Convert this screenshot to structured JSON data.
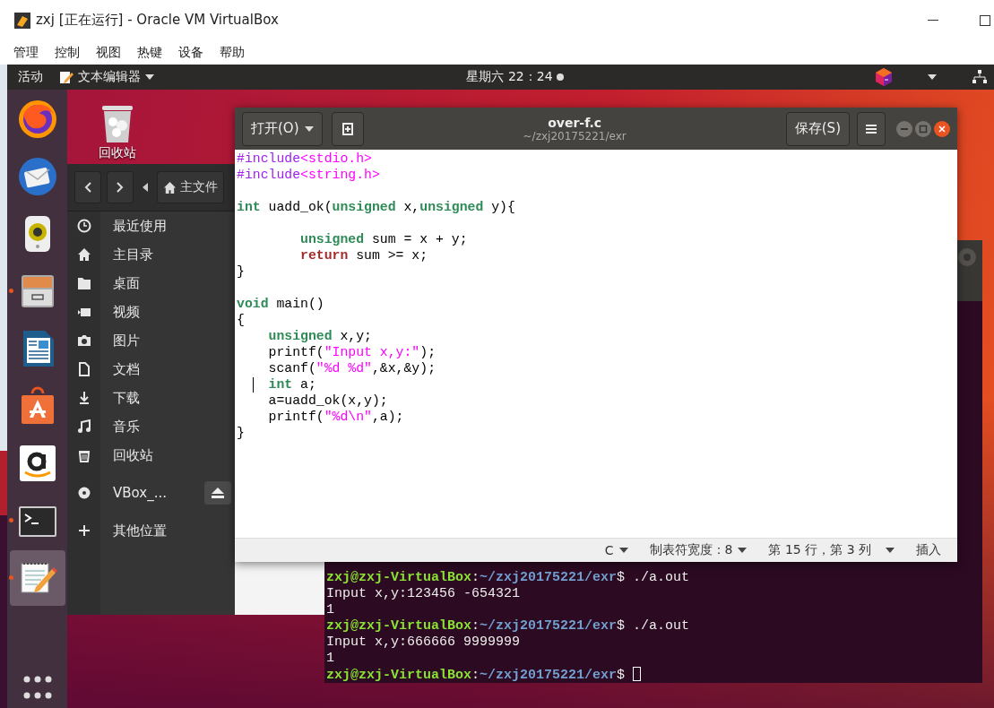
{
  "host_window": {
    "title": "zxj [正在运行] - Oracle VM VirtualBox",
    "menu": [
      "管理",
      "控制",
      "视图",
      "热键",
      "设备",
      "帮助"
    ]
  },
  "top_bar": {
    "activities": "活动",
    "app_menu": "文本编辑器",
    "clock": "星期六 22：24"
  },
  "dock": [
    {
      "kind": "firefox",
      "running": false,
      "selected": false
    },
    {
      "kind": "mail",
      "running": false,
      "selected": false
    },
    {
      "kind": "music",
      "running": false,
      "selected": false
    },
    {
      "kind": "files",
      "running": true,
      "selected": false
    },
    {
      "kind": "writer",
      "running": false,
      "selected": false
    },
    {
      "kind": "software",
      "running": false,
      "selected": false
    },
    {
      "kind": "amazon",
      "running": false,
      "selected": false
    },
    {
      "kind": "terminal",
      "running": true,
      "selected": false
    },
    {
      "kind": "editor",
      "running": true,
      "selected": true
    }
  ],
  "desktop_icons": [
    {
      "label": "回收站"
    }
  ],
  "file_manager": {
    "path": "主文件",
    "places": [
      {
        "kind": "recent",
        "label": "最近使用"
      },
      {
        "kind": "home",
        "label": "主目录"
      },
      {
        "kind": "desktop",
        "label": "桌面"
      },
      {
        "kind": "video",
        "label": "视频"
      },
      {
        "kind": "picture",
        "label": "图片"
      },
      {
        "kind": "document",
        "label": "文档"
      },
      {
        "kind": "download",
        "label": "下载"
      },
      {
        "kind": "music",
        "label": "音乐"
      },
      {
        "kind": "trash",
        "label": "回收站"
      },
      {
        "kind": "drive",
        "label": "VBox_..."
      },
      {
        "kind": "other",
        "label": "其他位置"
      }
    ]
  },
  "terminal": {
    "lines": [
      {
        "kind": "prompt",
        "user": "zxj@zxj-VirtualBox",
        "sep": ":",
        "path": "~/zxj20175221/exr",
        "dollar": "$",
        "command": " ./a.out",
        "cursor": false
      },
      {
        "kind": "output",
        "text": "Input x,y:123456 -654321"
      },
      {
        "kind": "output",
        "text": "1"
      },
      {
        "kind": "prompt",
        "user": "zxj@zxj-VirtualBox",
        "sep": ":",
        "path": "~/zxj20175221/exr",
        "dollar": "$",
        "command": " ./a.out",
        "cursor": false
      },
      {
        "kind": "output",
        "text": "Input x,y:666666 9999999"
      },
      {
        "kind": "output",
        "text": "1"
      },
      {
        "kind": "prompt",
        "user": "zxj@zxj-VirtualBox",
        "sep": ":",
        "path": "~/zxj20175221/exr",
        "dollar": "$",
        "cursor": true
      }
    ]
  },
  "editor": {
    "title": "over-f.c",
    "subtitle": "~/zxj20175221/exr",
    "open_button": "打开(O)",
    "save_button": "保存(S)",
    "lines": [
      {
        "kind": "top",
        "tokens": [
          {
            "text": "#include",
            "kind": "pre"
          },
          {
            "text": "<stdio.h>",
            "kind": "string"
          }
        ]
      },
      {
        "kind": "top",
        "tokens": [
          {
            "text": "#include",
            "kind": "pre"
          },
          {
            "text": "<string.h>",
            "kind": "string"
          }
        ]
      },
      {
        "kind": "blank"
      },
      {
        "kind": "top",
        "tokens": [
          {
            "text": "int",
            "kind": "type"
          },
          {
            "text": " uadd_ok(",
            "kind": "plain"
          },
          {
            "text": "unsigned",
            "kind": "type"
          },
          {
            "text": " x,",
            "kind": "plain"
          },
          {
            "text": "unsigned",
            "kind": "type"
          },
          {
            "text": " y){",
            "kind": "plain"
          }
        ]
      },
      {
        "kind": "blank"
      },
      {
        "kind": "nested",
        "tokens": [
          {
            "text": "unsigned",
            "kind": "type"
          },
          {
            "text": " sum = x + y;",
            "kind": "plain"
          }
        ]
      },
      {
        "kind": "nested",
        "tokens": [
          {
            "text": "return",
            "kind": "keyword"
          },
          {
            "text": " sum >= x;",
            "kind": "plain"
          }
        ]
      },
      {
        "kind": "top",
        "tokens": [
          {
            "text": "}",
            "kind": "plain"
          }
        ]
      },
      {
        "kind": "blank"
      },
      {
        "kind": "top",
        "tokens": [
          {
            "text": "void",
            "kind": "type"
          },
          {
            "text": " main()",
            "kind": "plain"
          }
        ]
      },
      {
        "kind": "top",
        "tokens": [
          {
            "text": "{",
            "kind": "plain"
          }
        ]
      },
      {
        "kind": "body",
        "tokens": [
          {
            "text": "unsigned",
            "kind": "type"
          },
          {
            "text": " x,y;",
            "kind": "plain"
          }
        ]
      },
      {
        "kind": "body",
        "tokens": [
          {
            "text": "printf(",
            "kind": "plain"
          },
          {
            "text": "\"Input x,y:\"",
            "kind": "string"
          },
          {
            "text": ");",
            "kind": "plain"
          }
        ]
      },
      {
        "kind": "body",
        "tokens": [
          {
            "text": "scanf(",
            "kind": "plain"
          },
          {
            "text": "\"%d %d\"",
            "kind": "string"
          },
          {
            "text": ",&x,&y);",
            "kind": "plain"
          }
        ]
      },
      {
        "kind": "body",
        "cursor": true,
        "tokens": [
          {
            "text": "int",
            "kind": "type"
          },
          {
            "text": " a;",
            "kind": "plain"
          }
        ]
      },
      {
        "kind": "body",
        "tokens": [
          {
            "text": "a=uadd_ok(x,y);",
            "kind": "plain"
          }
        ]
      },
      {
        "kind": "body",
        "tokens": [
          {
            "text": "printf(",
            "kind": "plain"
          },
          {
            "text": "\"%d\\n\"",
            "kind": "string"
          },
          {
            "text": ",a);",
            "kind": "plain"
          }
        ]
      },
      {
        "kind": "top",
        "tokens": [
          {
            "text": "}",
            "kind": "plain"
          }
        ]
      }
    ],
    "status": {
      "language": "C",
      "tab_width": "制表符宽度：8",
      "position": "第 15 行，第 3 列",
      "mode": "插入"
    }
  }
}
